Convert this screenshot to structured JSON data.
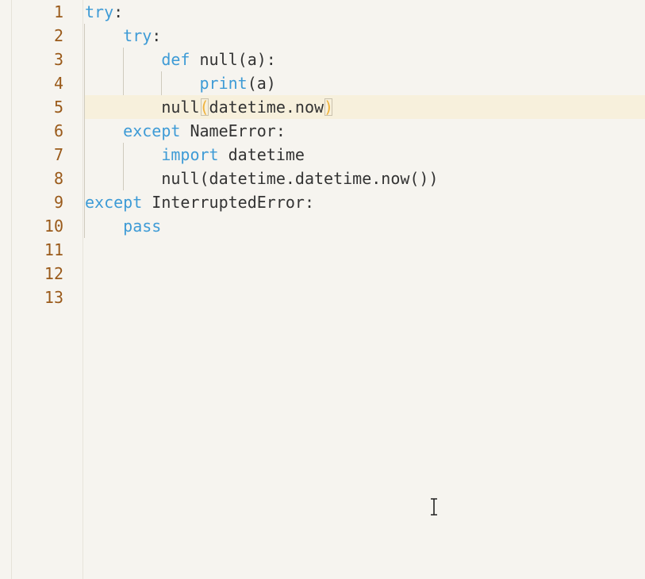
{
  "editor": {
    "line_numbers": [
      "1",
      "2",
      "3",
      "4",
      "5",
      "6",
      "7",
      "8",
      "9",
      "10",
      "11",
      "12",
      "13"
    ],
    "lines": [
      {
        "tokens": [
          {
            "t": "try",
            "c": "kw"
          },
          {
            "t": ":",
            "c": "id"
          }
        ]
      },
      {
        "tokens": [
          {
            "t": "    "
          },
          {
            "t": "try",
            "c": "kw"
          },
          {
            "t": ":",
            "c": "id"
          }
        ]
      },
      {
        "tokens": [
          {
            "t": "        "
          },
          {
            "t": "def",
            "c": "kw"
          },
          {
            "t": " null(a):",
            "c": "id"
          }
        ]
      },
      {
        "tokens": [
          {
            "t": "            "
          },
          {
            "t": "print",
            "c": "fn"
          },
          {
            "t": "(a)",
            "c": "id"
          }
        ]
      },
      {
        "tokens": [
          {
            "t": "        "
          },
          {
            "t": "null",
            "c": "id"
          },
          {
            "t": "(",
            "c": "bracket-match"
          },
          {
            "t": "datetime.now",
            "c": "id"
          },
          {
            "t": ")",
            "c": "bracket-match"
          }
        ]
      },
      {
        "tokens": [
          {
            "t": "    "
          },
          {
            "t": "except",
            "c": "kw"
          },
          {
            "t": " NameError:",
            "c": "id"
          }
        ]
      },
      {
        "tokens": [
          {
            "t": "        "
          },
          {
            "t": "import",
            "c": "kw"
          },
          {
            "t": " datetime",
            "c": "id"
          }
        ]
      },
      {
        "tokens": [
          {
            "t": "        "
          },
          {
            "t": "null(datetime.datetime.now())",
            "c": "id"
          }
        ]
      },
      {
        "tokens": [
          {
            "t": "except",
            "c": "kw"
          },
          {
            "t": " InterruptedError:",
            "c": "id"
          }
        ]
      },
      {
        "tokens": [
          {
            "t": "    "
          },
          {
            "t": "pass",
            "c": "kw"
          }
        ]
      },
      {
        "tokens": []
      },
      {
        "tokens": []
      },
      {
        "tokens": []
      }
    ],
    "current_line": 5,
    "colors": {
      "background": "#f6f4ef",
      "keyword": "#3e9bd6",
      "line_number": "#9a5a1a",
      "current_line": "#f7f0dc",
      "bracket_match": "#f0b23a"
    },
    "cursor_icon": "ibeam-cursor-icon"
  }
}
